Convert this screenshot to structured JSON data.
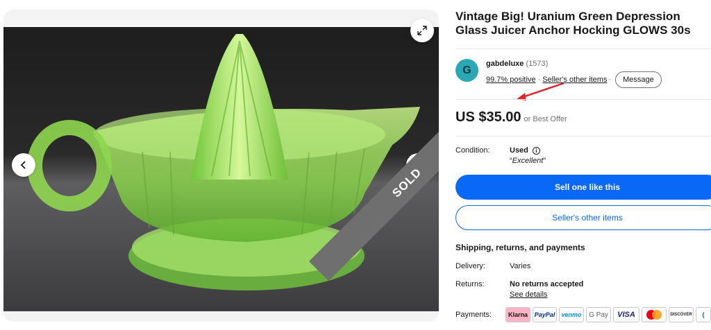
{
  "gallery": {
    "sold_label": "SOLD"
  },
  "listing": {
    "title": "Vintage Big! Uranium Green Depression Glass Juicer Anchor Hocking GLOWS 30s"
  },
  "seller": {
    "avatar_letter": "G",
    "name": "gabdeluxe",
    "feedback_count": "(1573)",
    "positive": "99.7% positive",
    "other_items": "Seller's other items",
    "message": "Message"
  },
  "price": {
    "amount": "US $35.00",
    "offer": "or Best Offer"
  },
  "condition": {
    "label": "Condition:",
    "value": "Used",
    "quote": "Excellent"
  },
  "buttons": {
    "sell_one": "Sell one like this",
    "other_items": "Seller's other items"
  },
  "shipping": {
    "title": "Shipping, returns, and payments",
    "delivery_label": "Delivery:",
    "delivery_value": "Varies",
    "returns_label": "Returns:",
    "returns_value": "No returns accepted",
    "see_details": "See details",
    "payments_label": "Payments:"
  },
  "payments": [
    "Klarna",
    "PayPal",
    "venmo",
    "G Pay",
    "VISA",
    "mastercard",
    "DISCOVER",
    "more"
  ],
  "colors": {
    "primary_blue": "#0968f6",
    "annotation_red": "#e3252b",
    "sold_gray": "#6f6f6f"
  }
}
